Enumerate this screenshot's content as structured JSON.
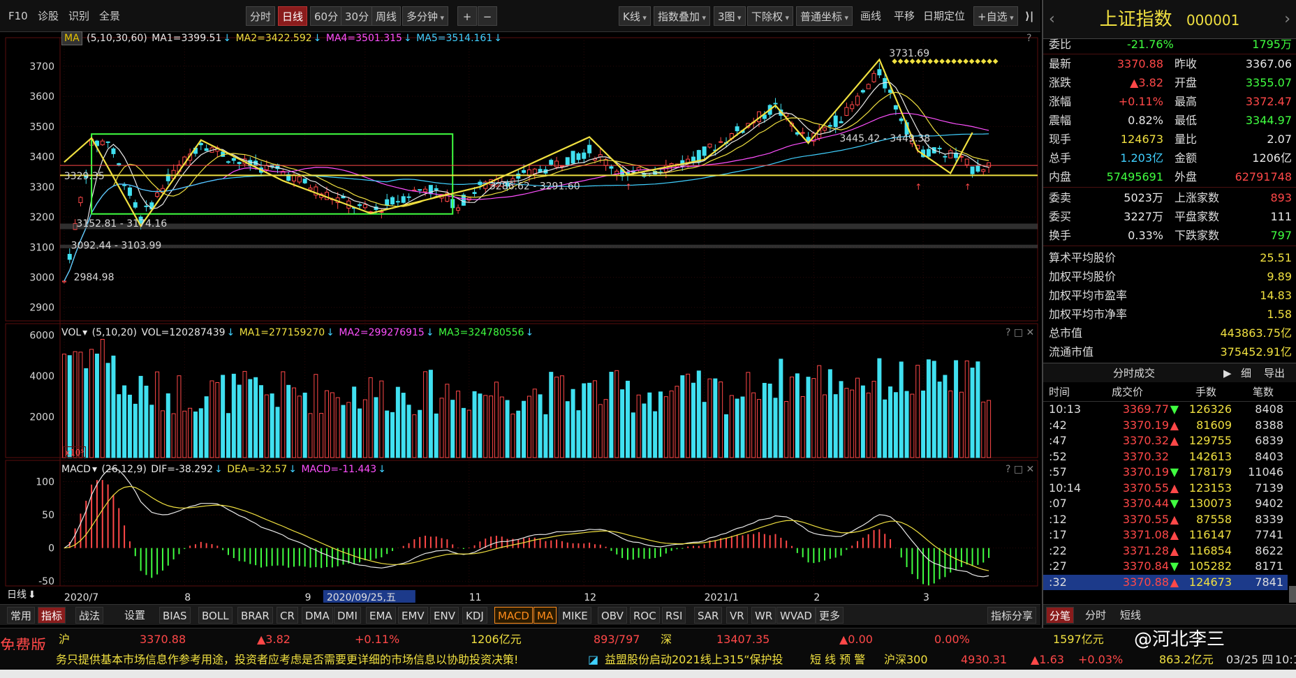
{
  "toolbar": {
    "left": [
      "F10",
      "诊股",
      "识别",
      "全景"
    ],
    "periods": [
      "分时",
      "日线",
      "60分",
      "30分",
      "周线",
      "多分钟"
    ],
    "active_period": "日线",
    "zoom": [
      "+",
      "−"
    ],
    "right": [
      "K线",
      "指数叠加",
      "3图",
      "下除权",
      "普通坐标",
      "画线",
      "平移",
      "日期定位",
      "+自选"
    ]
  },
  "price_panel": {
    "ma_badge": "MA",
    "params": "(5,10,30,60)",
    "ma1": "MA1=3399.51",
    "ma2": "MA2=3422.592",
    "ma4": "MA4=3501.315",
    "ma5": "MA5=3514.161",
    "annotations": [
      "3731.69",
      "3445.42 - 3449.38",
      "3286.62 - 3291.60",
      "3329.35",
      "3152.81 - 3174.16",
      "3092.44 - 3103.99",
      "2984.98"
    ],
    "help": "?"
  },
  "vol_panel": {
    "name": "VOL",
    "params": "(5,10,20)",
    "vol": "VOL=120287439",
    "ma1": "MA1=277159270",
    "ma2": "MA2=299276915",
    "ma3": "MA3=324780556",
    "unit": "x10⁵",
    "controls": "? □ ✕"
  },
  "macd_panel": {
    "name": "MACD",
    "params": "(26,12,9)",
    "dif": "DIF=-38.292",
    "dea": "DEA=-32.57",
    "macd": "MACD=-11.443",
    "controls": "? □ ✕"
  },
  "chart_data": [
    {
      "type": "candlestick",
      "title": "上证指数 日线",
      "y_ticks": [
        3700,
        3600,
        3500,
        3400,
        3300,
        3200,
        3100,
        3000,
        2900
      ],
      "ylim": [
        2860,
        3790
      ],
      "x_ticks": [
        "2020/7",
        "8",
        "9",
        "2020/09/25,五",
        "11",
        "12",
        "2021/1",
        "2",
        "3"
      ],
      "highlighted_x_label": "2020/09/25,五",
      "grid": true,
      "series": [
        {
          "name": "MA1"
        },
        {
          "name": "MA2"
        },
        {
          "name": "MA4"
        },
        {
          "name": "MA5"
        }
      ],
      "key_levels": [
        3731.69,
        3329.35,
        3286.62,
        3152.81,
        3092.44,
        2984.98
      ]
    },
    {
      "type": "bar",
      "title": "VOL",
      "y_ticks": [
        6000,
        4000,
        2000
      ],
      "ylim": [
        0,
        6500
      ]
    },
    {
      "type": "bar",
      "title": "MACD",
      "y_ticks": [
        100,
        50,
        0,
        -50
      ],
      "ylim": [
        -55,
        130
      ]
    }
  ],
  "axis_bottom": {
    "label": "日线"
  },
  "indicator_tabs": {
    "left": [
      "常用",
      "指标",
      "战法",
      "设置"
    ],
    "items": [
      "BIAS",
      "BOLL",
      "BRAR",
      "CR",
      "DMA",
      "DMI",
      "EMA",
      "EMV",
      "ENV",
      "KDJ",
      "MACD",
      "MA",
      "MIKE",
      "OBV",
      "ROC",
      "RSI",
      "SAR",
      "VR",
      "WR",
      "WVAD",
      "更多"
    ],
    "active": [
      "MACD",
      "MA"
    ],
    "share": "指标分享"
  },
  "right_panel": {
    "title": "上证指数",
    "code": "000001",
    "webi": {
      "label": "委比",
      "pct": "-21.76%",
      "val": "1795万"
    },
    "quotes": [
      {
        "l1": "最新",
        "v1": "3370.88",
        "c1": "#ff4848",
        "l2": "昨收",
        "v2": "3367.06",
        "c2": "#e8e8e8"
      },
      {
        "l1": "涨跌",
        "v1": "▲3.82",
        "c1": "#ff4848",
        "l2": "开盘",
        "v2": "3355.07",
        "c2": "#40ff40"
      },
      {
        "l1": "涨幅",
        "v1": "+0.11%",
        "c1": "#ff4848",
        "l2": "最高",
        "v2": "3372.47",
        "c2": "#ff4848"
      },
      {
        "l1": "震幅",
        "v1": "0.82%",
        "c1": "#e8e8e8",
        "l2": "最低",
        "v2": "3344.97",
        "c2": "#40ff40"
      },
      {
        "l1": "现手",
        "v1": "124673",
        "c1": "#f0e040",
        "l2": "量比",
        "v2": "2.07",
        "c2": "#e8e8e8"
      },
      {
        "l1": "总手",
        "v1": "1.203亿",
        "c1": "#40d0ff",
        "l2": "金额",
        "v2": "1206亿",
        "c2": "#e8e8e8"
      },
      {
        "l1": "内盘",
        "v1": "57495691",
        "c1": "#40ff40",
        "l2": "外盘",
        "v2": "62791748",
        "c2": "#ff4848"
      }
    ],
    "orders": [
      {
        "l1": "委卖",
        "v1": "5023万",
        "c1": "#e8e8e8",
        "l2": "上涨家数",
        "v2": "893",
        "c2": "#ff4848"
      },
      {
        "l1": "委买",
        "v1": "3227万",
        "c1": "#e8e8e8",
        "l2": "平盘家数",
        "v2": "111",
        "c2": "#e8e8e8"
      },
      {
        "l1": "换手",
        "v1": "0.33%",
        "c1": "#e8e8e8",
        "l2": "下跌家数",
        "v2": "797",
        "c2": "#40ff40"
      }
    ],
    "stats": [
      {
        "l": "算术平均股价",
        "v": "25.51"
      },
      {
        "l": "加权平均股价",
        "v": "9.89"
      },
      {
        "l": "加权平均市盈率",
        "v": "14.83"
      },
      {
        "l": "加权平均市净率",
        "v": "1.58"
      },
      {
        "l": "总市值",
        "v": "443863.75亿"
      },
      {
        "l": "流通市值",
        "v": "375452.91亿"
      }
    ],
    "ticks_header": {
      "title": "分时成交",
      "btn1": "细",
      "btn2": "导出"
    },
    "ticks_cols": [
      "时间",
      "成交价",
      "手数",
      "笔数"
    ],
    "ticks": [
      {
        "t": "10:13",
        "p": "3369.77",
        "d": "▼",
        "h": "126326",
        "n": "8408"
      },
      {
        "t": ":42",
        "p": "3370.19",
        "d": "▲",
        "h": "81609",
        "n": "8388"
      },
      {
        "t": ":47",
        "p": "3370.32",
        "d": "▲",
        "h": "129755",
        "n": "6839"
      },
      {
        "t": ":52",
        "p": "3370.32",
        "d": "",
        "h": "142613",
        "n": "8403"
      },
      {
        "t": ":57",
        "p": "3370.19",
        "d": "▼",
        "h": "178179",
        "n": "11046"
      },
      {
        "t": "10:14",
        "p": "3370.55",
        "d": "▲",
        "h": "123153",
        "n": "7139"
      },
      {
        "t": ":07",
        "p": "3370.44",
        "d": "▼",
        "h": "130073",
        "n": "9402"
      },
      {
        "t": ":12",
        "p": "3370.55",
        "d": "▲",
        "h": "87558",
        "n": "8339"
      },
      {
        "t": ":17",
        "p": "3371.08",
        "d": "▲",
        "h": "116147",
        "n": "7741"
      },
      {
        "t": ":22",
        "p": "3371.28",
        "d": "▲",
        "h": "116854",
        "n": "8622"
      },
      {
        "t": ":27",
        "p": "3370.84",
        "d": "▼",
        "h": "105282",
        "n": "8171"
      },
      {
        "t": ":32",
        "p": "3370.88",
        "d": "▲",
        "h": "124673",
        "n": "7841"
      }
    ],
    "bottom_tabs": [
      "分笔",
      "分时",
      "短线"
    ]
  },
  "status": {
    "free": "免费版",
    "sh": "沪",
    "sh_price": "3370.88",
    "sh_chg": "▲3.82",
    "sh_pct": "+0.11%",
    "sh_amt": "1206亿元",
    "sh_breadth": "893/797",
    "sz": "深",
    "sz_price": "13407.35",
    "sz_chg": "▲0.00",
    "sz_pct": "0.00%",
    "sz_amt": "1597亿元",
    "watermark": "@河北李三",
    "disclaimer": "务只提供基本市场信息作参考用途，投资者应考虑是否需要更详细的市场信息以协助投资决策!",
    "news": "益盟股份启动2021线上315“保护投",
    "alert": "短 线 预 警",
    "hs300": "沪深300",
    "hs300_price": "4930.31",
    "hs300_chg": "▲1.63",
    "hs300_pct": "+0.03%",
    "hs300_amt": "863.2亿元",
    "date": "03/25 四",
    "time": "10:1"
  }
}
